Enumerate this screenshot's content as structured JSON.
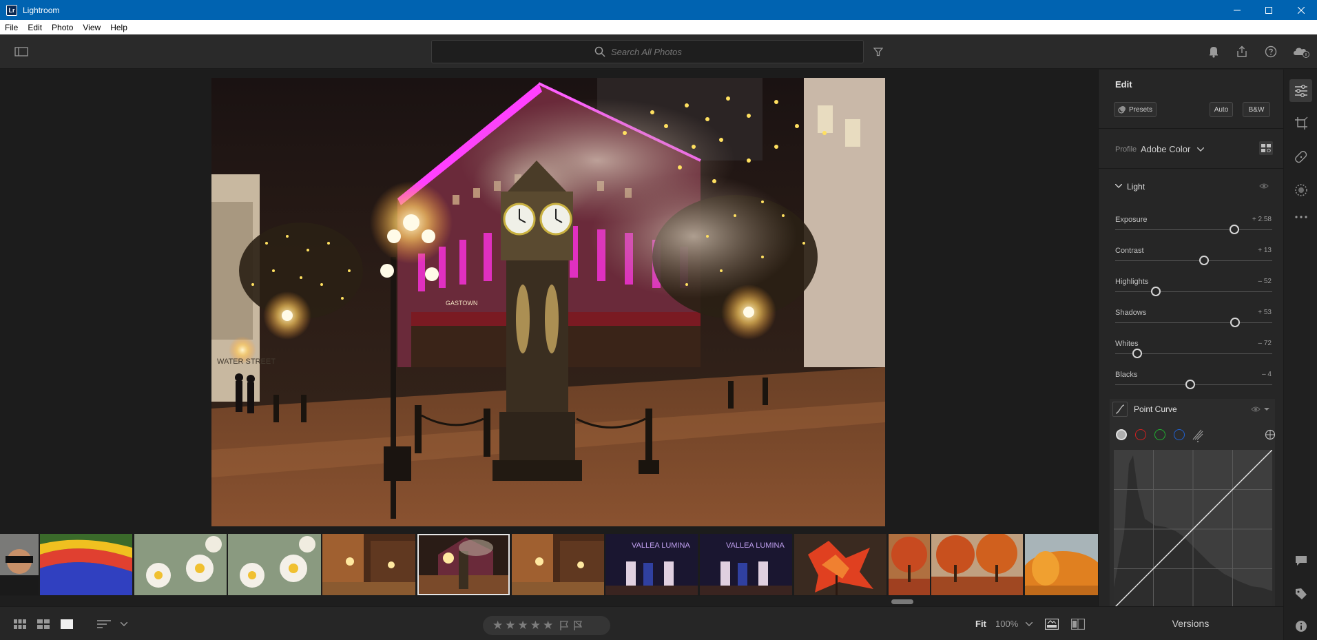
{
  "window": {
    "title": "Lightroom",
    "logo_text": "Lr"
  },
  "menu": {
    "items": [
      "File",
      "Edit",
      "Photo",
      "View",
      "Help"
    ]
  },
  "search": {
    "placeholder": "Search All Photos"
  },
  "edit_panel": {
    "title": "Edit",
    "presets_label": "Presets",
    "auto_label": "Auto",
    "bw_label": "B&W",
    "profile_label": "Profile",
    "profile_value": "Adobe Color",
    "light_section": "Light",
    "sliders": [
      {
        "label": "Exposure",
        "value": "+ 2.58",
        "position": 0.76
      },
      {
        "label": "Contrast",
        "value": "+ 13",
        "position": 0.565
      },
      {
        "label": "Highlights",
        "value": "– 52",
        "position": 0.26
      },
      {
        "label": "Shadows",
        "value": "+ 53",
        "position": 0.765
      },
      {
        "label": "Whites",
        "value": "– 72",
        "position": 0.14
      },
      {
        "label": "Blacks",
        "value": "– 4",
        "position": 0.48
      }
    ],
    "point_curve_label": "Point Curve"
  },
  "bottom": {
    "zoom_fit": "Fit",
    "zoom_percent": "100%",
    "versions_label": "Versions"
  },
  "photo_overlay": {
    "sign_text": "GASTOWN",
    "street_text": "WATER STREET"
  },
  "filmstrip": {
    "lumina_text": "VALLEA LUMINA"
  },
  "colors": {
    "titlebar": "#0063b1",
    "panel": "#262626",
    "background": "#1c1c1c"
  }
}
